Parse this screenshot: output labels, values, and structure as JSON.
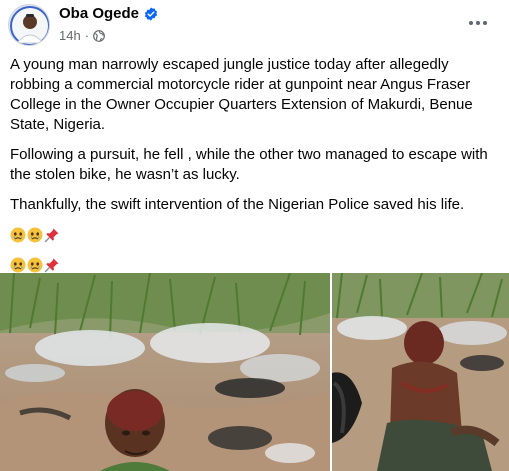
{
  "post": {
    "author": "Oba Ogede",
    "timestamp": "14h",
    "separator": "·",
    "privacy_icon": "globe-icon",
    "verified_icon": "verified-badge-icon",
    "more_icon": "more-options-icon",
    "paragraphs": [
      "A young man narrowly escaped jungle justice today after allegedly robbing a commercial motorcycle rider at gunpoint near Angus Fraser College in the Owner Occupier Quarters Extension of Makurdi, Benue State, Nigeria.",
      "Following a pursuit, he fell , while the other two managed to escape with the stolen bike, he wasn’t as lucky.",
      "Thankfully, the swift intervention of the Nigerian Police saved his life."
    ],
    "emoji_lines": [
      [
        "crying-face-emoji",
        "crying-face-emoji",
        "pushpin-emoji"
      ],
      [
        "crying-face-emoji",
        "crying-face-emoji",
        "pushpin-emoji"
      ]
    ],
    "photos": [
      "post-photo-1",
      "post-photo-2"
    ]
  },
  "colors": {
    "text": "#050505",
    "secondary_text": "#65676b",
    "verified_blue": "#0866ff",
    "background": "#ffffff"
  }
}
